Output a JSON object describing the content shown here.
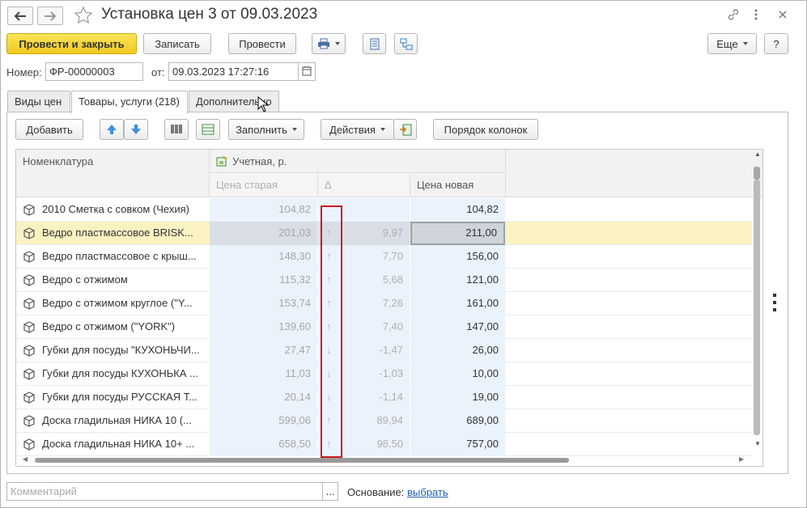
{
  "window": {
    "title": "Установка цен 3 от 09.03.2023"
  },
  "toolbar": {
    "post_close": "Провести и закрыть",
    "save": "Записать",
    "post": "Провести",
    "more": "Еще",
    "help": "?"
  },
  "header": {
    "number_label": "Номер:",
    "number_value": "ФР-00000003",
    "date_label": "от:",
    "date_value": "09.03.2023 17:27:16"
  },
  "tabs": [
    {
      "label": "Виды цен"
    },
    {
      "label": "Товары, услуги (218)"
    },
    {
      "label": "Дополнительно"
    }
  ],
  "table_toolbar": {
    "add": "Добавить",
    "fill": "Заполнить",
    "actions": "Действия",
    "column_order": "Порядок колонок"
  },
  "columns": {
    "name": "Номенклатура",
    "group": "Учетная, р.",
    "old_price": "Цена старая",
    "delta": "Δ",
    "new_price": "Цена новая"
  },
  "rows": [
    {
      "name": "2010 Сметка с совком (Чехия)",
      "old": "104,82",
      "arrow": "",
      "delta": "",
      "new": "104,82"
    },
    {
      "name": "Ведро пластмассовое BRISK...",
      "old": "201,03",
      "arrow": "↑",
      "delta": "9,97",
      "new": "211,00"
    },
    {
      "name": "Ведро пластмассовое с крыш...",
      "old": "148,30",
      "arrow": "↑",
      "delta": "7,70",
      "new": "156,00"
    },
    {
      "name": "Ведро с отжимом",
      "old": "115,32",
      "arrow": "↑",
      "delta": "5,68",
      "new": "121,00"
    },
    {
      "name": "Ведро с отжимом  круглое (\"Y...",
      "old": "153,74",
      "arrow": "↑",
      "delta": "7,26",
      "new": "161,00"
    },
    {
      "name": "Ведро с отжимом (\"YORK\")",
      "old": "139,60",
      "arrow": "↑",
      "delta": "7,40",
      "new": "147,00"
    },
    {
      "name": "Губки для посуды \"КУХОНЬЧИ...",
      "old": "27,47",
      "arrow": "↓",
      "delta": "-1,47",
      "new": "26,00"
    },
    {
      "name": "Губки для посуды КУХОНЬКА ...",
      "old": "11,03",
      "arrow": "↓",
      "delta": "-1,03",
      "new": "10,00"
    },
    {
      "name": "Губки для посуды РУССКАЯ Т...",
      "old": "20,14",
      "arrow": "↓",
      "delta": "-1,14",
      "new": "19,00"
    },
    {
      "name": "Доска гладильная  НИКА 10 (...",
      "old": "599,06",
      "arrow": "↑",
      "delta": "89,94",
      "new": "689,00"
    },
    {
      "name": "Доска гладильная  НИКА 10+ ...",
      "old": "658,50",
      "arrow": "↑",
      "delta": "98,50",
      "new": "757,00"
    }
  ],
  "footer": {
    "comment_placeholder": "Комментарий",
    "basis_label": "Основание:",
    "basis_link": "выбрать"
  }
}
